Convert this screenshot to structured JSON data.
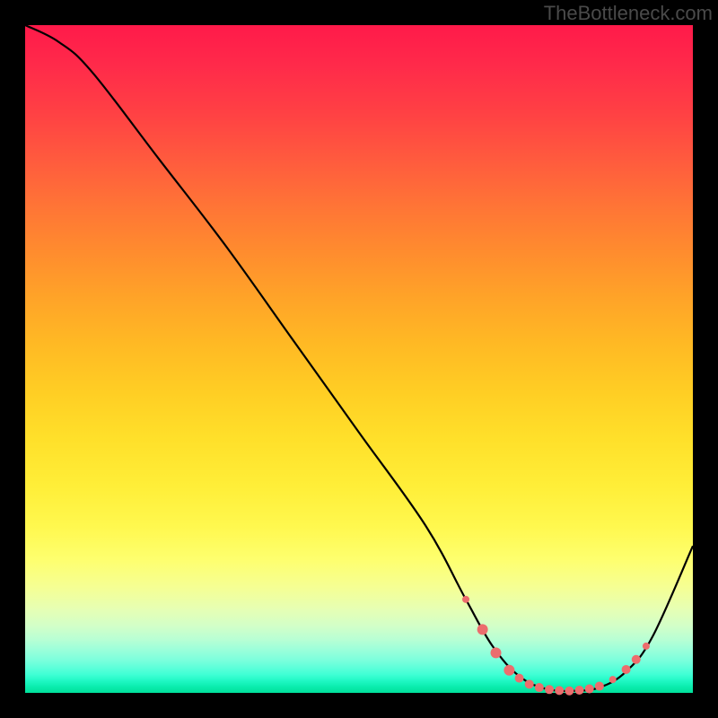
{
  "watermark": "TheBottleneck.com",
  "chart_data": {
    "type": "line",
    "title": "",
    "xlabel": "",
    "ylabel": "",
    "xlim": [
      0,
      100
    ],
    "ylim": [
      0,
      100
    ],
    "grid": false,
    "curve": [
      {
        "x": 0,
        "y": 100
      },
      {
        "x": 5,
        "y": 97.5
      },
      {
        "x": 10,
        "y": 93
      },
      {
        "x": 20,
        "y": 80
      },
      {
        "x": 30,
        "y": 67
      },
      {
        "x": 40,
        "y": 53
      },
      {
        "x": 50,
        "y": 39
      },
      {
        "x": 60,
        "y": 25
      },
      {
        "x": 66,
        "y": 14
      },
      {
        "x": 70,
        "y": 7
      },
      {
        "x": 74,
        "y": 2.5
      },
      {
        "x": 78,
        "y": 0.6
      },
      {
        "x": 82,
        "y": 0.3
      },
      {
        "x": 86,
        "y": 0.8
      },
      {
        "x": 90,
        "y": 3.2
      },
      {
        "x": 94,
        "y": 8.5
      },
      {
        "x": 100,
        "y": 22
      }
    ],
    "markers": [
      {
        "x": 66.0,
        "y": 14.0,
        "r": 4
      },
      {
        "x": 68.5,
        "y": 9.5,
        "r": 6
      },
      {
        "x": 70.5,
        "y": 6.0,
        "r": 6
      },
      {
        "x": 72.5,
        "y": 3.4,
        "r": 6
      },
      {
        "x": 74.0,
        "y": 2.2,
        "r": 5
      },
      {
        "x": 75.5,
        "y": 1.3,
        "r": 5
      },
      {
        "x": 77.0,
        "y": 0.8,
        "r": 5
      },
      {
        "x": 78.5,
        "y": 0.5,
        "r": 5
      },
      {
        "x": 80.0,
        "y": 0.35,
        "r": 5
      },
      {
        "x": 81.5,
        "y": 0.3,
        "r": 5
      },
      {
        "x": 83.0,
        "y": 0.4,
        "r": 5
      },
      {
        "x": 84.5,
        "y": 0.6,
        "r": 5
      },
      {
        "x": 86.0,
        "y": 1.0,
        "r": 5
      },
      {
        "x": 88.0,
        "y": 2.0,
        "r": 4
      },
      {
        "x": 90.0,
        "y": 3.5,
        "r": 5
      },
      {
        "x": 91.5,
        "y": 5.0,
        "r": 5
      },
      {
        "x": 93.0,
        "y": 7.0,
        "r": 4
      }
    ],
    "marker_color": "#ec6d6d",
    "line_color": "#000000"
  }
}
